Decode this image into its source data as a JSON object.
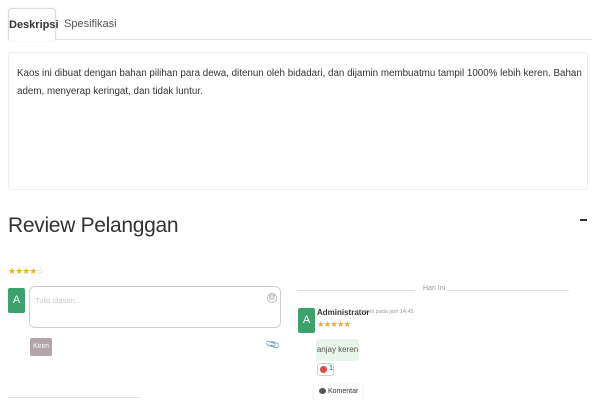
{
  "tabs": [
    {
      "label": "Deskripsi",
      "active": true
    },
    {
      "label": "Spesifikasi",
      "active": false
    }
  ],
  "description": "Kaos ini dibuat dengan bahan pilihan para dewa, ditenun oleh bidadari, dan dijamin membuatmu tampil 1000% lebih keren. Bahan adem, menyerap keringat, dan tidak luntur.",
  "review": {
    "title": "Review Pelanggan",
    "collapse_icon": "minus-icon",
    "rating_filled": 4,
    "rating_max": 5,
    "star_color": "#e4b419",
    "input": {
      "avatar_letter": "A",
      "placeholder": "Tulis ulasan...",
      "send_label": "Kirim",
      "avatar_color": "#3aa26a",
      "send_color": "#b2a4a9"
    },
    "feed": {
      "day_label": "Hari Ini",
      "comments": [
        {
          "avatar_letter": "A",
          "author": "Administrator",
          "meta": "Hari ini pada jam 14.45",
          "stars": "★★★★★",
          "text": "anjay keren",
          "reaction_count": "1",
          "comment_label": "Komentar",
          "bubble_color": "#e8f5ea"
        }
      ]
    }
  }
}
